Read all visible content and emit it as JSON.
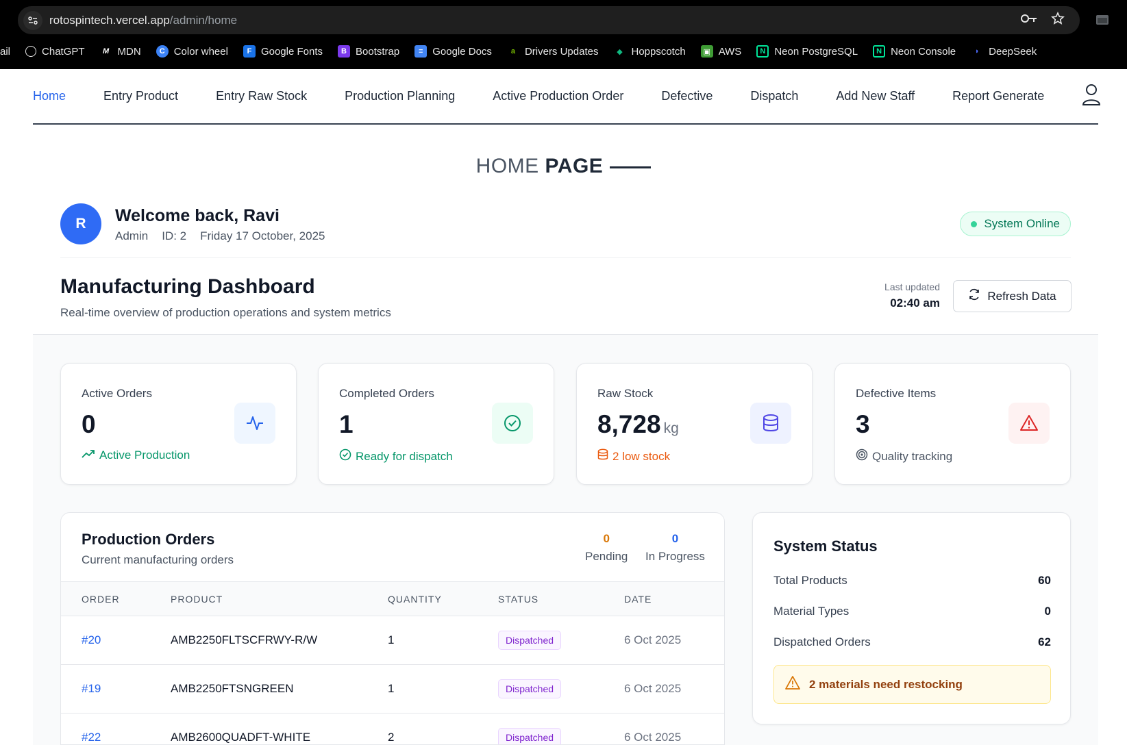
{
  "browser": {
    "url_host": "rotospintech.vercel.app",
    "url_path": "/admin/home",
    "bookmarks": [
      {
        "label": "ail",
        "icon": "none"
      },
      {
        "label": "ChatGPT",
        "icon": "chatgpt-icon"
      },
      {
        "label": "MDN",
        "icon": "mdn-icon"
      },
      {
        "label": "Color wheel",
        "icon": "color-wheel-icon"
      },
      {
        "label": "Google Fonts",
        "icon": "google-fonts-icon"
      },
      {
        "label": "Bootstrap",
        "icon": "bootstrap-icon"
      },
      {
        "label": "Google Docs",
        "icon": "google-docs-icon"
      },
      {
        "label": "Drivers Updates",
        "icon": "nvidia-icon"
      },
      {
        "label": "Hoppscotch",
        "icon": "hoppscotch-icon"
      },
      {
        "label": "AWS",
        "icon": "aws-icon"
      },
      {
        "label": "Neon PostgreSQL",
        "icon": "neon-icon"
      },
      {
        "label": "Neon Console",
        "icon": "neon-icon"
      },
      {
        "label": "DeepSeek",
        "icon": "deepseek-icon"
      }
    ]
  },
  "nav": {
    "items": [
      "Home",
      "Entry Product",
      "Entry Raw Stock",
      "Production Planning",
      "Active Production Order",
      "Defective",
      "Dispatch",
      "Add New Staff",
      "Report Generate"
    ],
    "active": "Home",
    "user_icon": "user-icon"
  },
  "page_title": {
    "light": "HOME",
    "bold": "PAGE"
  },
  "welcome": {
    "avatar_letter": "R",
    "greeting": "Welcome back, Ravi",
    "role": "Admin",
    "id": "ID: 2",
    "date": "Friday 17 October, 2025",
    "status": "System Online"
  },
  "dashboard": {
    "title": "Manufacturing Dashboard",
    "subtitle": "Real-time overview of production operations and system metrics",
    "last_updated_label": "Last updated",
    "last_updated_value": "02:40 am",
    "refresh_label": "Refresh Data"
  },
  "cards": [
    {
      "label": "Active Orders",
      "value": "0",
      "unit": "",
      "footer": "Active Production",
      "footer_color": "#059669",
      "icon": "activity-icon",
      "icon_color": "#2563eb",
      "icon_bg": "#eff6ff"
    },
    {
      "label": "Completed Orders",
      "value": "1",
      "unit": "",
      "footer": "Ready for dispatch",
      "footer_color": "#059669",
      "icon": "check-circle-icon",
      "icon_color": "#059669",
      "icon_bg": "#ecfdf5"
    },
    {
      "label": "Raw Stock",
      "value": "8,728",
      "unit": "kg",
      "footer": "2 low stock",
      "footer_color": "#ea580c",
      "icon": "database-icon",
      "icon_color": "#4f46e5",
      "icon_bg": "#eef2ff"
    },
    {
      "label": "Defective Items",
      "value": "3",
      "unit": "",
      "footer": "Quality tracking",
      "footer_color": "#4b5563",
      "icon": "alert-triangle-icon",
      "icon_color": "#dc2626",
      "icon_bg": "#fef2f2"
    }
  ],
  "orders": {
    "title": "Production Orders",
    "subtitle": "Current manufacturing orders",
    "pending_count": "0",
    "pending_label": "Pending",
    "progress_count": "0",
    "progress_label": "In Progress",
    "columns": [
      "ORDER",
      "PRODUCT",
      "QUANTITY",
      "STATUS",
      "DATE"
    ],
    "rows": [
      {
        "order": "#20",
        "product": "AMB2250FLTSCFRWY-R/W",
        "quantity": "1",
        "status": "Dispatched",
        "date": "6 Oct 2025"
      },
      {
        "order": "#19",
        "product": "AMB2250FTSNGREEN",
        "quantity": "1",
        "status": "Dispatched",
        "date": "6 Oct 2025"
      },
      {
        "order": "#22",
        "product": "AMB2600QUADFT-WHITE",
        "quantity": "2",
        "status": "Dispatched",
        "date": "6 Oct 2025"
      }
    ]
  },
  "system_status": {
    "title": "System Status",
    "rows": [
      {
        "label": "Total Products",
        "value": "60"
      },
      {
        "label": "Material Types",
        "value": "0"
      },
      {
        "label": "Dispatched Orders",
        "value": "62"
      }
    ],
    "warning": "2 materials need restocking"
  }
}
